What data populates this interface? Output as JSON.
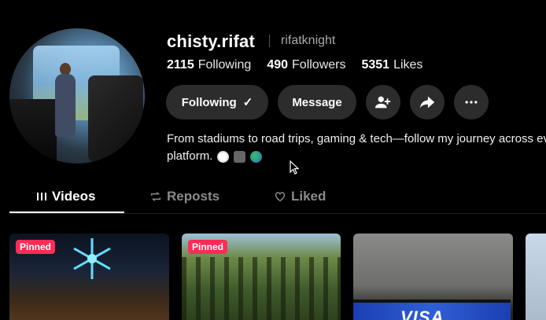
{
  "profile": {
    "username": "chisty.rifat",
    "handle": "rifatknight",
    "stats": [
      {
        "value": "2115",
        "label": "Following"
      },
      {
        "value": "490",
        "label": "Followers"
      },
      {
        "value": "5351",
        "label": "Likes"
      }
    ],
    "bio_line1": "From stadiums to road trips, gaming & tech—follow my journey across every",
    "bio_line2": "platform."
  },
  "actions": {
    "following_label": "Following",
    "following_check": "✓",
    "message_label": "Message"
  },
  "tabs": [
    {
      "label": "Videos",
      "icon": "grid-icon"
    },
    {
      "label": "Reposts",
      "icon": "repost-icon"
    },
    {
      "label": "Liked",
      "icon": "heart-icon"
    }
  ],
  "videos": [
    {
      "badge": "Pinned"
    },
    {
      "badge": "Pinned"
    },
    {
      "tv_text": "VISA"
    }
  ],
  "colors": {
    "pinned_badge": "#fe2c55",
    "button_bg": "#2c2c2c",
    "muted_text": "#8a8a8a"
  }
}
